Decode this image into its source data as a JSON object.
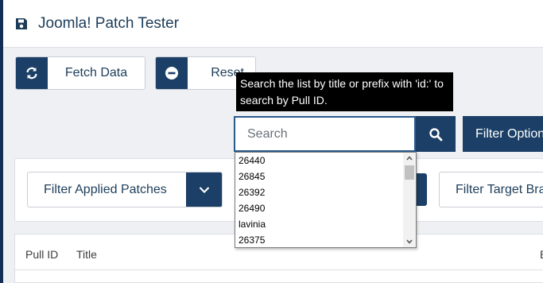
{
  "header": {
    "title": "Joomla! Patch Tester",
    "icon": "save-icon"
  },
  "toolbar": {
    "fetch_label": "Fetch Data",
    "fetch_icon": "refresh-icon",
    "reset_label": "Reset",
    "reset_icon": "minus-circle-icon"
  },
  "search": {
    "tooltip": "Search the list by title or prefix with 'id:' to search by Pull ID.",
    "placeholder": "Search",
    "value": "",
    "button_icon": "search-icon",
    "filter_options_label": "Filter Options"
  },
  "autocomplete": {
    "options": [
      "26440",
      "26845",
      "26392",
      "26490",
      "lavinia",
      "26375"
    ]
  },
  "filters": {
    "applied_label": "Filter Applied Patches",
    "target_label": "Filter Target Branch"
  },
  "table": {
    "columns": [
      "Pull ID",
      "Title",
      "B"
    ]
  },
  "colors": {
    "primary": "#1b3f66",
    "text": "#1c3d5a",
    "background": "#eef0f3"
  }
}
